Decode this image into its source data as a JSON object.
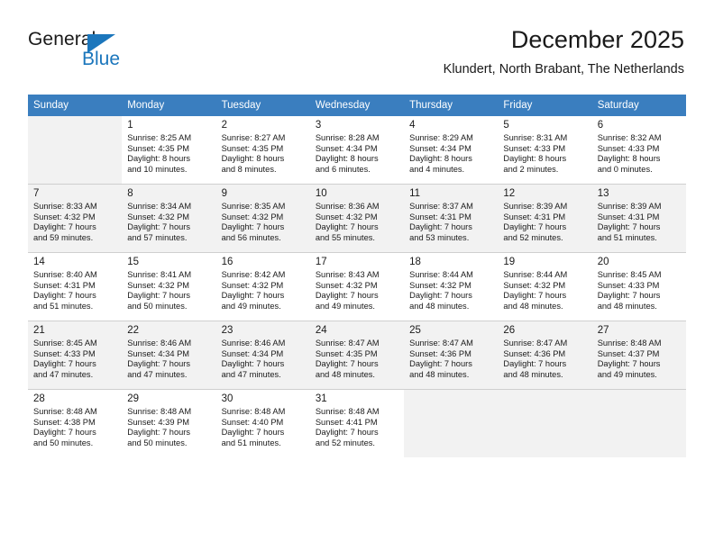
{
  "brand": {
    "name_part1": "General",
    "name_part2": "Blue",
    "triangle_color": "#1b76bc"
  },
  "header": {
    "title": "December 2025",
    "subtitle": "Klundert, North Brabant, The Netherlands",
    "header_bg": "#3a7ebf"
  },
  "weekdays": [
    "Sunday",
    "Monday",
    "Tuesday",
    "Wednesday",
    "Thursday",
    "Friday",
    "Saturday"
  ],
  "weeks": [
    {
      "shaded": false,
      "days": [
        {
          "num": "",
          "sunrise": "",
          "sunset": "",
          "daylight1": "",
          "daylight2": ""
        },
        {
          "num": "1",
          "sunrise": "Sunrise: 8:25 AM",
          "sunset": "Sunset: 4:35 PM",
          "daylight1": "Daylight: 8 hours",
          "daylight2": "and 10 minutes."
        },
        {
          "num": "2",
          "sunrise": "Sunrise: 8:27 AM",
          "sunset": "Sunset: 4:35 PM",
          "daylight1": "Daylight: 8 hours",
          "daylight2": "and 8 minutes."
        },
        {
          "num": "3",
          "sunrise": "Sunrise: 8:28 AM",
          "sunset": "Sunset: 4:34 PM",
          "daylight1": "Daylight: 8 hours",
          "daylight2": "and 6 minutes."
        },
        {
          "num": "4",
          "sunrise": "Sunrise: 8:29 AM",
          "sunset": "Sunset: 4:34 PM",
          "daylight1": "Daylight: 8 hours",
          "daylight2": "and 4 minutes."
        },
        {
          "num": "5",
          "sunrise": "Sunrise: 8:31 AM",
          "sunset": "Sunset: 4:33 PM",
          "daylight1": "Daylight: 8 hours",
          "daylight2": "and 2 minutes."
        },
        {
          "num": "6",
          "sunrise": "Sunrise: 8:32 AM",
          "sunset": "Sunset: 4:33 PM",
          "daylight1": "Daylight: 8 hours",
          "daylight2": "and 0 minutes."
        }
      ]
    },
    {
      "shaded": true,
      "days": [
        {
          "num": "7",
          "sunrise": "Sunrise: 8:33 AM",
          "sunset": "Sunset: 4:32 PM",
          "daylight1": "Daylight: 7 hours",
          "daylight2": "and 59 minutes."
        },
        {
          "num": "8",
          "sunrise": "Sunrise: 8:34 AM",
          "sunset": "Sunset: 4:32 PM",
          "daylight1": "Daylight: 7 hours",
          "daylight2": "and 57 minutes."
        },
        {
          "num": "9",
          "sunrise": "Sunrise: 8:35 AM",
          "sunset": "Sunset: 4:32 PM",
          "daylight1": "Daylight: 7 hours",
          "daylight2": "and 56 minutes."
        },
        {
          "num": "10",
          "sunrise": "Sunrise: 8:36 AM",
          "sunset": "Sunset: 4:32 PM",
          "daylight1": "Daylight: 7 hours",
          "daylight2": "and 55 minutes."
        },
        {
          "num": "11",
          "sunrise": "Sunrise: 8:37 AM",
          "sunset": "Sunset: 4:31 PM",
          "daylight1": "Daylight: 7 hours",
          "daylight2": "and 53 minutes."
        },
        {
          "num": "12",
          "sunrise": "Sunrise: 8:39 AM",
          "sunset": "Sunset: 4:31 PM",
          "daylight1": "Daylight: 7 hours",
          "daylight2": "and 52 minutes."
        },
        {
          "num": "13",
          "sunrise": "Sunrise: 8:39 AM",
          "sunset": "Sunset: 4:31 PM",
          "daylight1": "Daylight: 7 hours",
          "daylight2": "and 51 minutes."
        }
      ]
    },
    {
      "shaded": false,
      "days": [
        {
          "num": "14",
          "sunrise": "Sunrise: 8:40 AM",
          "sunset": "Sunset: 4:31 PM",
          "daylight1": "Daylight: 7 hours",
          "daylight2": "and 51 minutes."
        },
        {
          "num": "15",
          "sunrise": "Sunrise: 8:41 AM",
          "sunset": "Sunset: 4:32 PM",
          "daylight1": "Daylight: 7 hours",
          "daylight2": "and 50 minutes."
        },
        {
          "num": "16",
          "sunrise": "Sunrise: 8:42 AM",
          "sunset": "Sunset: 4:32 PM",
          "daylight1": "Daylight: 7 hours",
          "daylight2": "and 49 minutes."
        },
        {
          "num": "17",
          "sunrise": "Sunrise: 8:43 AM",
          "sunset": "Sunset: 4:32 PM",
          "daylight1": "Daylight: 7 hours",
          "daylight2": "and 49 minutes."
        },
        {
          "num": "18",
          "sunrise": "Sunrise: 8:44 AM",
          "sunset": "Sunset: 4:32 PM",
          "daylight1": "Daylight: 7 hours",
          "daylight2": "and 48 minutes."
        },
        {
          "num": "19",
          "sunrise": "Sunrise: 8:44 AM",
          "sunset": "Sunset: 4:32 PM",
          "daylight1": "Daylight: 7 hours",
          "daylight2": "and 48 minutes."
        },
        {
          "num": "20",
          "sunrise": "Sunrise: 8:45 AM",
          "sunset": "Sunset: 4:33 PM",
          "daylight1": "Daylight: 7 hours",
          "daylight2": "and 48 minutes."
        }
      ]
    },
    {
      "shaded": true,
      "days": [
        {
          "num": "21",
          "sunrise": "Sunrise: 8:45 AM",
          "sunset": "Sunset: 4:33 PM",
          "daylight1": "Daylight: 7 hours",
          "daylight2": "and 47 minutes."
        },
        {
          "num": "22",
          "sunrise": "Sunrise: 8:46 AM",
          "sunset": "Sunset: 4:34 PM",
          "daylight1": "Daylight: 7 hours",
          "daylight2": "and 47 minutes."
        },
        {
          "num": "23",
          "sunrise": "Sunrise: 8:46 AM",
          "sunset": "Sunset: 4:34 PM",
          "daylight1": "Daylight: 7 hours",
          "daylight2": "and 47 minutes."
        },
        {
          "num": "24",
          "sunrise": "Sunrise: 8:47 AM",
          "sunset": "Sunset: 4:35 PM",
          "daylight1": "Daylight: 7 hours",
          "daylight2": "and 48 minutes."
        },
        {
          "num": "25",
          "sunrise": "Sunrise: 8:47 AM",
          "sunset": "Sunset: 4:36 PM",
          "daylight1": "Daylight: 7 hours",
          "daylight2": "and 48 minutes."
        },
        {
          "num": "26",
          "sunrise": "Sunrise: 8:47 AM",
          "sunset": "Sunset: 4:36 PM",
          "daylight1": "Daylight: 7 hours",
          "daylight2": "and 48 minutes."
        },
        {
          "num": "27",
          "sunrise": "Sunrise: 8:48 AM",
          "sunset": "Sunset: 4:37 PM",
          "daylight1": "Daylight: 7 hours",
          "daylight2": "and 49 minutes."
        }
      ]
    },
    {
      "shaded": false,
      "days": [
        {
          "num": "28",
          "sunrise": "Sunrise: 8:48 AM",
          "sunset": "Sunset: 4:38 PM",
          "daylight1": "Daylight: 7 hours",
          "daylight2": "and 50 minutes."
        },
        {
          "num": "29",
          "sunrise": "Sunrise: 8:48 AM",
          "sunset": "Sunset: 4:39 PM",
          "daylight1": "Daylight: 7 hours",
          "daylight2": "and 50 minutes."
        },
        {
          "num": "30",
          "sunrise": "Sunrise: 8:48 AM",
          "sunset": "Sunset: 4:40 PM",
          "daylight1": "Daylight: 7 hours",
          "daylight2": "and 51 minutes."
        },
        {
          "num": "31",
          "sunrise": "Sunrise: 8:48 AM",
          "sunset": "Sunset: 4:41 PM",
          "daylight1": "Daylight: 7 hours",
          "daylight2": "and 52 minutes."
        },
        {
          "num": "",
          "sunrise": "",
          "sunset": "",
          "daylight1": "",
          "daylight2": ""
        },
        {
          "num": "",
          "sunrise": "",
          "sunset": "",
          "daylight1": "",
          "daylight2": ""
        },
        {
          "num": "",
          "sunrise": "",
          "sunset": "",
          "daylight1": "",
          "daylight2": ""
        }
      ]
    }
  ]
}
